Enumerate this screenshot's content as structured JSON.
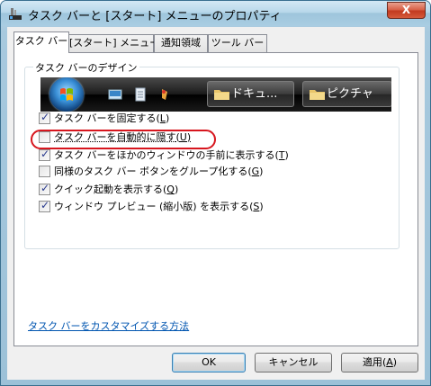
{
  "window": {
    "title": "タスク バーと [スタート] メニューのプロパティ",
    "close_glyph": "X"
  },
  "tabs": [
    {
      "label": "タスク バー",
      "active": true
    },
    {
      "label": "[スタート] メニュー",
      "active": false
    },
    {
      "label": "通知領域",
      "active": false
    },
    {
      "label": "ツール バー",
      "active": false
    }
  ],
  "group": {
    "legend": "タスク バーのデザイン"
  },
  "taskbar_preview": {
    "button1": "ドキュ...",
    "button2": "ピクチャ",
    "icons": [
      "start-orb-icon",
      "show-desktop-icon",
      "notepad-icon",
      "media-icon",
      "folder-icon"
    ]
  },
  "options": [
    {
      "text": "タスク バーを固定する",
      "key": "L",
      "checked": true
    },
    {
      "text": "タスク バーを自動的に隠す",
      "key": "U",
      "checked": false
    },
    {
      "text": "タスク バーをほかのウィンドウの手前に表示する",
      "key": "T",
      "checked": true
    },
    {
      "text": "同様のタスク バー ボタンをグループ化する",
      "key": "G",
      "checked": false
    },
    {
      "text": "クイック起動を表示する",
      "key": "Q",
      "checked": true
    },
    {
      "text": "ウィンドウ プレビュー (縮小版) を表示する",
      "key": "S",
      "checked": true
    }
  ],
  "help_link": "タスク バーをカスタマイズする方法",
  "buttons": {
    "ok": "OK",
    "cancel": "キャンセル",
    "apply": "適用",
    "apply_key": "A"
  },
  "colors": {
    "highlight": "#d7161e",
    "link": "#0055b0",
    "check": "#2a3b8f"
  }
}
